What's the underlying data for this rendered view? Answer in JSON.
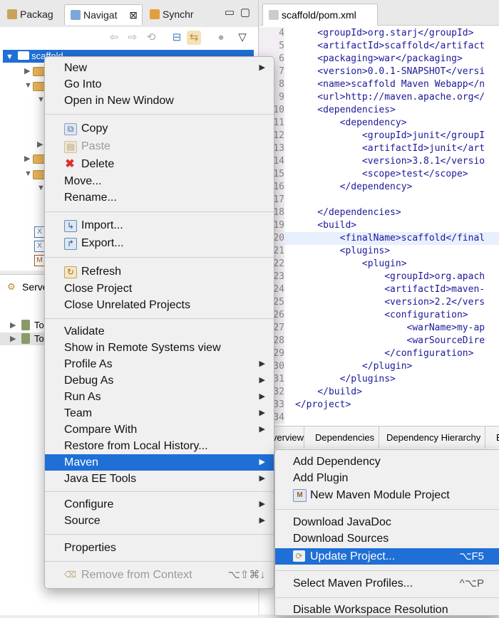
{
  "nav_tabs": [
    {
      "label": "Packag"
    },
    {
      "label": "Navigat",
      "close": "⊠"
    },
    {
      "label": "Synchr"
    }
  ],
  "tree": {
    "root_label": "scaffold"
  },
  "servers": {
    "tab_label": "Serve",
    "rows": [
      {
        "label": "To"
      },
      {
        "label": "To"
      }
    ]
  },
  "editor": {
    "tab_label": "scaffold/pom.xml",
    "lines": [
      {
        "num": "4",
        "text": "    <groupId>org.starj</groupId>"
      },
      {
        "num": "5",
        "text": "    <artifactId>scaffold</artifact"
      },
      {
        "num": "6",
        "text": "    <packaging>war</packaging>"
      },
      {
        "num": "7",
        "text": "    <version>0.0.1-SNAPSHOT</versi"
      },
      {
        "num": "8",
        "text": "    <name>scaffold Maven Webapp</n"
      },
      {
        "num": "9",
        "text": "    <url>http://maven.apache.org</"
      },
      {
        "num": "10",
        "text": "    <dependencies>"
      },
      {
        "num": "11",
        "text": "        <dependency>"
      },
      {
        "num": "12",
        "text": "            <groupId>junit</groupI"
      },
      {
        "num": "13",
        "text": "            <artifactId>junit</art"
      },
      {
        "num": "14",
        "text": "            <version>3.8.1</versio"
      },
      {
        "num": "15",
        "text": "            <scope>test</scope>"
      },
      {
        "num": "16",
        "text": "        </dependency>"
      },
      {
        "num": "17",
        "text": ""
      },
      {
        "num": "18",
        "text": "    </dependencies>"
      },
      {
        "num": "19",
        "text": "    <build>"
      },
      {
        "num": "20",
        "text": "        <finalName>scaffold</final"
      },
      {
        "num": "21",
        "text": "        <plugins>"
      },
      {
        "num": "22",
        "text": "            <plugin>"
      },
      {
        "num": "23",
        "text": "                <groupId>org.apach"
      },
      {
        "num": "24",
        "text": "                <artifactId>maven-"
      },
      {
        "num": "25",
        "text": "                <version>2.2</vers"
      },
      {
        "num": "26",
        "text": "                <configuration>"
      },
      {
        "num": "27",
        "text": "                    <warName>my-ap"
      },
      {
        "num": "28",
        "text": "                    <warSourceDire"
      },
      {
        "num": "29",
        "text": "                </configuration>"
      },
      {
        "num": "30",
        "text": "            </plugin>"
      },
      {
        "num": "31",
        "text": "        </plugins>"
      },
      {
        "num": "32",
        "text": "    </build>"
      },
      {
        "num": "33",
        "text": "</project>"
      },
      {
        "num": "34",
        "text": ""
      }
    ],
    "bottom_tabs": [
      {
        "label": "verview"
      },
      {
        "label": "Dependencies"
      },
      {
        "label": "Dependency Hierarchy"
      },
      {
        "label": "E"
      }
    ]
  },
  "context_menu": {
    "items": [
      {
        "label": "New",
        "submenu": "▶"
      },
      {
        "label": "Go Into"
      },
      {
        "label": "Open in New Window"
      },
      {
        "label": "Copy"
      },
      {
        "label": "Paste"
      },
      {
        "label": "Delete"
      },
      {
        "label": "Move..."
      },
      {
        "label": "Rename..."
      },
      {
        "label": "Import..."
      },
      {
        "label": "Export..."
      },
      {
        "label": "Refresh"
      },
      {
        "label": "Close Project"
      },
      {
        "label": "Close Unrelated Projects"
      },
      {
        "label": "Validate"
      },
      {
        "label": "Show in Remote Systems view"
      },
      {
        "label": "Profile As",
        "submenu": "▶"
      },
      {
        "label": "Debug As",
        "submenu": "▶"
      },
      {
        "label": "Run As",
        "submenu": "▶"
      },
      {
        "label": "Team",
        "submenu": "▶"
      },
      {
        "label": "Compare With",
        "submenu": "▶"
      },
      {
        "label": "Restore from Local History..."
      },
      {
        "label": "Maven",
        "submenu": "▶"
      },
      {
        "label": "Java EE Tools",
        "submenu": "▶"
      },
      {
        "label": "Configure",
        "submenu": "▶"
      },
      {
        "label": "Source",
        "submenu": "▶"
      },
      {
        "label": "Properties"
      },
      {
        "label": "Remove from Context",
        "shortcut": "⌥⇧⌘↓"
      }
    ]
  },
  "maven_submenu": {
    "items": [
      {
        "label": "Add Dependency"
      },
      {
        "label": "Add Plugin"
      },
      {
        "label": "New Maven Module Project"
      },
      {
        "label": "Download JavaDoc"
      },
      {
        "label": "Download Sources"
      },
      {
        "label": "Update Project...",
        "shortcut": "⌥F5"
      },
      {
        "label": "Select Maven Profiles...",
        "shortcut": "^⌥P"
      },
      {
        "label": "Disable Workspace Resolution"
      }
    ]
  },
  "colors": {
    "selection": "#1f6fd6",
    "menu_bg": "#f0f0f0",
    "tag": "#1a1a9a"
  }
}
